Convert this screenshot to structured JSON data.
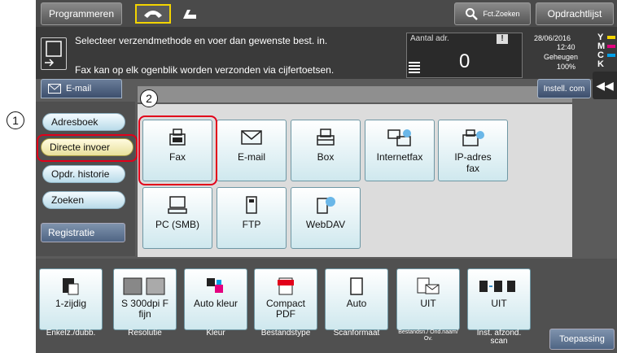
{
  "topbar": {
    "programmeren": "Programmeren",
    "fct_zoeken": "Fct.Zoeken",
    "opdrachtlijst": "Opdrachtlijst"
  },
  "message": {
    "line1": "Selecteer verzendmethode en voer dan gewenste best. in.",
    "line2": "Fax kan op elk ogenblik worden verzonden via cijfertoetsen.",
    "aantal_label": "Aantal adr.",
    "aantal_value": "0",
    "date": "28/06/2016",
    "time": "12:40",
    "geheugen": "Geheugen",
    "geheugen_pct": "100%",
    "toner": [
      "Y",
      "M",
      "C",
      "K"
    ]
  },
  "tabs": {
    "email": "E-mail",
    "instell": "Instell. com"
  },
  "left_menu": [
    {
      "label": "Adresboek"
    },
    {
      "label": "Directe invoer"
    },
    {
      "label": "Opdr. historie"
    },
    {
      "label": "Zoeken"
    },
    {
      "label": "Registratie"
    }
  ],
  "methods": [
    {
      "label": "Fax",
      "icon": "fax-icon"
    },
    {
      "label": "E-mail",
      "icon": "email-icon"
    },
    {
      "label": "Box",
      "icon": "box-icon"
    },
    {
      "label": "Internetfax",
      "icon": "internetfax-icon"
    },
    {
      "label": "IP-adres fax",
      "icon": "ipfax-icon"
    },
    {
      "label": "PC (SMB)",
      "icon": "pc-icon"
    },
    {
      "label": "FTP",
      "icon": "ftp-icon"
    },
    {
      "label": "WebDAV",
      "icon": "webdav-icon"
    }
  ],
  "settings": [
    {
      "value": "1-zijdig",
      "label": "Enkelz./dubb."
    },
    {
      "value": "S 300dpi F fijn",
      "label": "Resolutie"
    },
    {
      "value": "Auto kleur",
      "label": "Kleur"
    },
    {
      "value": "Compact PDF",
      "label": "Bestandstype"
    },
    {
      "value": "Auto",
      "label": "Scanformaat"
    },
    {
      "value": "UIT",
      "label": "Bestandsn./ Ond.naam/ Ov."
    },
    {
      "value": "UIT",
      "label": "Inst. afzond. scan"
    }
  ],
  "toepassing": "Toepassing",
  "callouts": [
    "1",
    "2"
  ],
  "colors": {
    "highlight": "#e2001a",
    "selected": "#e8e09b",
    "tile_border": "#6e97a4"
  }
}
